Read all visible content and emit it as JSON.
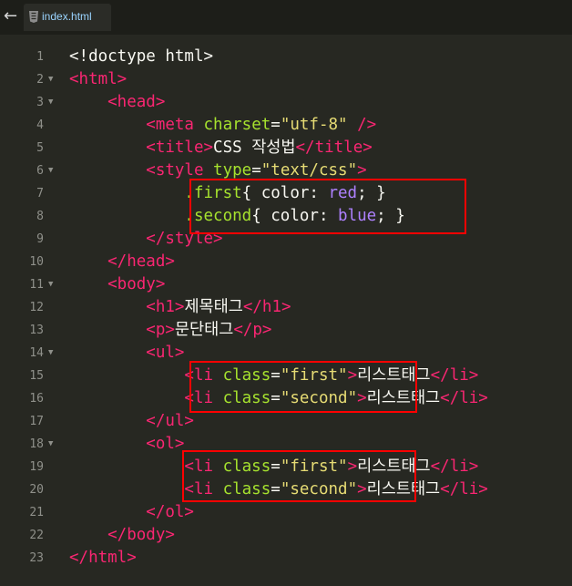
{
  "tab": {
    "title": "index.html"
  },
  "lines": [
    {
      "n": "1",
      "fold": false,
      "parts": [
        {
          "t": "<!doctype html>",
          "c": "plain"
        }
      ]
    },
    {
      "n": "2",
      "fold": true,
      "parts": [
        {
          "t": "<html>",
          "c": "tag"
        }
      ]
    },
    {
      "n": "3",
      "fold": true,
      "parts": [
        {
          "t": "    <head>",
          "c": "tag"
        }
      ]
    },
    {
      "n": "4",
      "fold": false,
      "parts": [
        {
          "t": "        <meta ",
          "c": "tag"
        },
        {
          "t": "charset",
          "c": "attr"
        },
        {
          "t": "=",
          "c": "plain"
        },
        {
          "t": "\"utf-8\"",
          "c": "str"
        },
        {
          "t": " />",
          "c": "tag"
        }
      ]
    },
    {
      "n": "5",
      "fold": false,
      "parts": [
        {
          "t": "        <title>",
          "c": "tag"
        },
        {
          "t": "CSS 작성법",
          "c": "plain"
        },
        {
          "t": "</title>",
          "c": "tag"
        }
      ]
    },
    {
      "n": "6",
      "fold": true,
      "parts": [
        {
          "t": "        <style ",
          "c": "tag"
        },
        {
          "t": "type",
          "c": "attr"
        },
        {
          "t": "=",
          "c": "plain"
        },
        {
          "t": "\"text/css\"",
          "c": "str"
        },
        {
          "t": ">",
          "c": "tag"
        }
      ]
    },
    {
      "n": "7",
      "fold": false,
      "parts": [
        {
          "t": "            .first",
          "c": "attr"
        },
        {
          "t": "{ color: ",
          "c": "plain"
        },
        {
          "t": "red",
          "c": "val"
        },
        {
          "t": "; }",
          "c": "plain"
        }
      ]
    },
    {
      "n": "8",
      "fold": false,
      "parts": [
        {
          "t": "            .second",
          "c": "attr"
        },
        {
          "t": "{ color: ",
          "c": "plain"
        },
        {
          "t": "blue",
          "c": "val"
        },
        {
          "t": "; }",
          "c": "plain"
        }
      ]
    },
    {
      "n": "9",
      "fold": false,
      "parts": [
        {
          "t": "        </style>",
          "c": "tag"
        }
      ]
    },
    {
      "n": "10",
      "fold": false,
      "parts": [
        {
          "t": "    </head>",
          "c": "tag"
        }
      ]
    },
    {
      "n": "11",
      "fold": true,
      "parts": [
        {
          "t": "    <body>",
          "c": "tag"
        }
      ]
    },
    {
      "n": "12",
      "fold": false,
      "parts": [
        {
          "t": "        <h1>",
          "c": "tag"
        },
        {
          "t": "제목태그",
          "c": "plain"
        },
        {
          "t": "</h1>",
          "c": "tag"
        }
      ]
    },
    {
      "n": "13",
      "fold": false,
      "parts": [
        {
          "t": "        <p>",
          "c": "tag"
        },
        {
          "t": "문단태그",
          "c": "plain"
        },
        {
          "t": "</p>",
          "c": "tag"
        }
      ]
    },
    {
      "n": "14",
      "fold": true,
      "parts": [
        {
          "t": "        <ul>",
          "c": "tag"
        }
      ]
    },
    {
      "n": "15",
      "fold": false,
      "parts": [
        {
          "t": "            <li ",
          "c": "tag"
        },
        {
          "t": "class",
          "c": "attr"
        },
        {
          "t": "=",
          "c": "plain"
        },
        {
          "t": "\"first\"",
          "c": "str"
        },
        {
          "t": ">",
          "c": "tag"
        },
        {
          "t": "리스트태그",
          "c": "plain"
        },
        {
          "t": "</li>",
          "c": "tag"
        }
      ]
    },
    {
      "n": "16",
      "fold": false,
      "parts": [
        {
          "t": "            <li ",
          "c": "tag"
        },
        {
          "t": "class",
          "c": "attr"
        },
        {
          "t": "=",
          "c": "plain"
        },
        {
          "t": "\"second\"",
          "c": "str"
        },
        {
          "t": ">",
          "c": "tag"
        },
        {
          "t": "리스트태그",
          "c": "plain"
        },
        {
          "t": "</li>",
          "c": "tag"
        }
      ]
    },
    {
      "n": "17",
      "fold": false,
      "parts": [
        {
          "t": "        </ul>",
          "c": "tag"
        }
      ]
    },
    {
      "n": "18",
      "fold": true,
      "parts": [
        {
          "t": "        <ol>",
          "c": "tag"
        }
      ]
    },
    {
      "n": "19",
      "fold": false,
      "parts": [
        {
          "t": "            <li ",
          "c": "tag"
        },
        {
          "t": "class",
          "c": "attr"
        },
        {
          "t": "=",
          "c": "plain"
        },
        {
          "t": "\"first\"",
          "c": "str"
        },
        {
          "t": ">",
          "c": "tag"
        },
        {
          "t": "리스트태그",
          "c": "plain"
        },
        {
          "t": "</li>",
          "c": "tag"
        }
      ]
    },
    {
      "n": "20",
      "fold": false,
      "parts": [
        {
          "t": "            <li ",
          "c": "tag"
        },
        {
          "t": "class",
          "c": "attr"
        },
        {
          "t": "=",
          "c": "plain"
        },
        {
          "t": "\"second\"",
          "c": "str"
        },
        {
          "t": ">",
          "c": "tag"
        },
        {
          "t": "리스트태그",
          "c": "plain"
        },
        {
          "t": "</li>",
          "c": "tag"
        }
      ]
    },
    {
      "n": "21",
      "fold": false,
      "parts": [
        {
          "t": "        </ol>",
          "c": "tag"
        }
      ]
    },
    {
      "n": "22",
      "fold": false,
      "parts": [
        {
          "t": "    </body>",
          "c": "tag"
        }
      ]
    },
    {
      "n": "23",
      "fold": false,
      "parts": [
        {
          "t": "</html>",
          "c": "tag"
        }
      ]
    }
  ],
  "icons": {
    "back": "back-arrow-icon",
    "file": "html5-file-icon",
    "fold": "fold-arrow-icon"
  },
  "colors": {
    "tag": "#f92672",
    "attr": "#a6e22e",
    "string": "#e6db74",
    "value": "#ae81ff",
    "text": "#f8f8f2",
    "highlight": "#ff0000"
  }
}
